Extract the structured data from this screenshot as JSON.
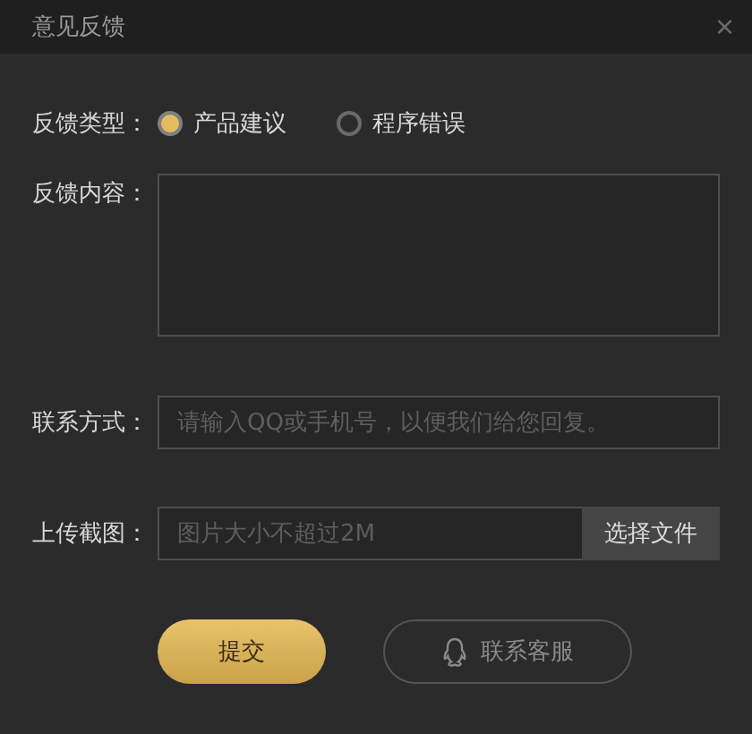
{
  "window": {
    "title": "意见反馈",
    "close": "×"
  },
  "feedback_type": {
    "label": "反馈类型：",
    "options": [
      {
        "label": "产品建议",
        "selected": true
      },
      {
        "label": "程序错误",
        "selected": false
      }
    ]
  },
  "content": {
    "label": "反馈内容："
  },
  "contact": {
    "label": "联系方式：",
    "placeholder": "请输入QQ或手机号，以便我们给您回复。"
  },
  "upload": {
    "label": "上传截图：",
    "placeholder": "图片大小不超过2M",
    "button": "选择文件"
  },
  "buttons": [
    {
      "kind": "primary",
      "label": "提交"
    },
    {
      "kind": "service",
      "label": "联系客服"
    }
  ]
}
